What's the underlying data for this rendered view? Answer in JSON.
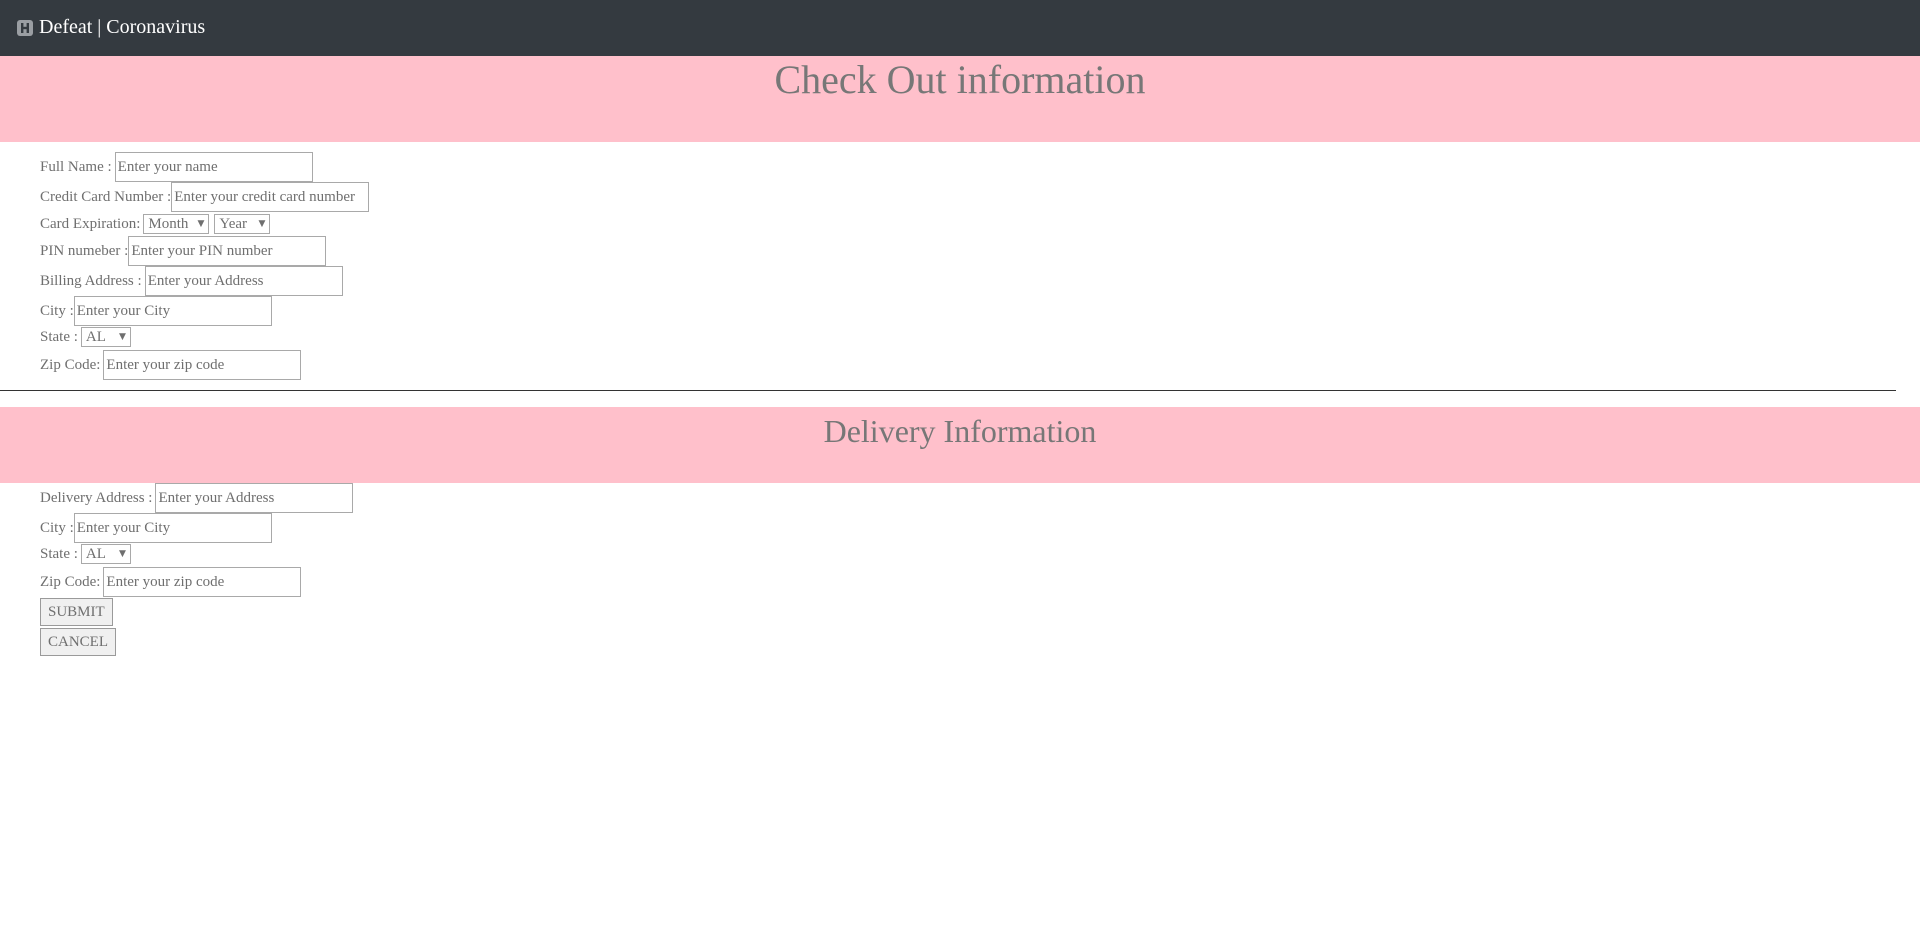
{
  "navbar": {
    "brand_icon": "h-square-icon",
    "brand_text": "Defeat | Coronavirus",
    "background": "#343a40"
  },
  "checkout": {
    "title": "Check Out information",
    "banner_color": "#ffc0cb",
    "full_name": {
      "label": "Full Name :",
      "placeholder": "Enter your name"
    },
    "credit_card": {
      "label": "Credit Card Number :",
      "placeholder": "Enter your credit card number"
    },
    "expiration": {
      "label": "Card Expiration:",
      "month": "Month",
      "year": "Year"
    },
    "pin": {
      "label": "PIN numeber :",
      "placeholder": "Enter your PIN number"
    },
    "billing_address": {
      "label": "Billing Address :",
      "placeholder": "Enter your Address"
    },
    "city": {
      "label": "City :",
      "placeholder": "Enter your City"
    },
    "state": {
      "label": "State :",
      "value": "AL"
    },
    "zip": {
      "label": "Zip Code:",
      "placeholder": "Enter your zip code"
    }
  },
  "delivery": {
    "title": "Delivery Information",
    "address": {
      "label": "Delivery Address :",
      "placeholder": "Enter your Address"
    },
    "city": {
      "label": "City :",
      "placeholder": "Enter your City"
    },
    "state": {
      "label": "State :",
      "value": "AL"
    },
    "zip": {
      "label": "Zip Code:",
      "placeholder": "Enter your zip code"
    }
  },
  "buttons": {
    "submit": "SUBMIT",
    "cancel": "CANCEL"
  }
}
